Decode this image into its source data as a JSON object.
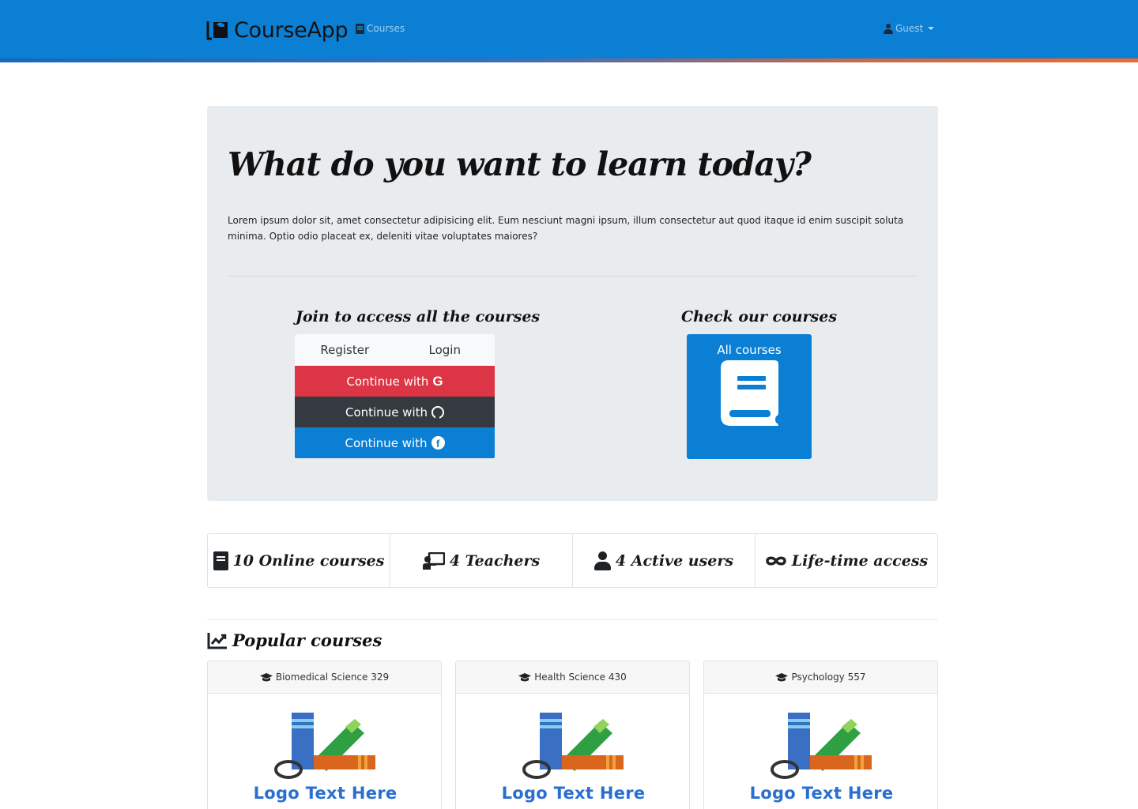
{
  "navbar": {
    "brand": "CourseApp",
    "courses_link": "Courses",
    "user_menu": "Guest"
  },
  "hero": {
    "title": "What do you want to learn today?",
    "lead": "Lorem ipsum dolor sit, amet consectetur adipisicing elit. Eum nesciunt magni ipsum, illum consectetur aut quod itaque id enim suscipit soluta minima. Optio odio placeat ex, deleniti vitae voluptates maiores?",
    "join": {
      "title": "Join to access all the courses",
      "tabs": [
        "Register",
        "Login"
      ],
      "buttons": [
        {
          "label": "Continue with",
          "icon": "google-icon",
          "color": "#dc3545"
        },
        {
          "label": "Continue with",
          "icon": "github-icon",
          "color": "#343a40"
        },
        {
          "label": "Continue with",
          "icon": "facebook-icon",
          "color": "#0b7fd4"
        }
      ]
    },
    "check": {
      "title": "Check our courses",
      "button_label": "All courses",
      "icon": "book-icon"
    }
  },
  "stats": [
    {
      "icon": "book-icon",
      "label": "10 Online courses"
    },
    {
      "icon": "chalkboard-teacher-icon",
      "label": "4 Teachers"
    },
    {
      "icon": "user-icon",
      "label": "4 Active users"
    },
    {
      "icon": "infinity-icon",
      "label": "Life-time access"
    }
  ],
  "popular": {
    "title": "Popular courses",
    "icon": "chart-line-icon",
    "courses": [
      {
        "title": "Biomedical Science 329",
        "icon": "graduation-cap-icon",
        "logo_text": "Logo Text Here"
      },
      {
        "title": "Health Science 430",
        "icon": "graduation-cap-icon",
        "logo_text": "Logo Text Here"
      },
      {
        "title": "Psychology 557",
        "icon": "graduation-cap-icon",
        "logo_text": "Logo Text Here"
      }
    ]
  },
  "colors": {
    "primary": "#0b7fd4",
    "danger": "#dc3545",
    "dark": "#343a40",
    "jumbotron": "#e9ecef"
  }
}
